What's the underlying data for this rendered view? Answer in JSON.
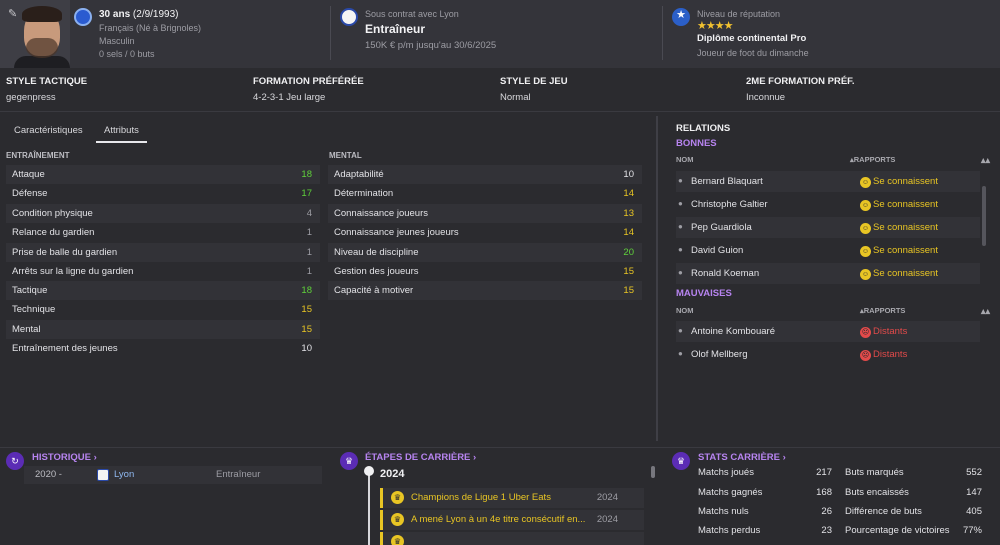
{
  "header": {
    "age": "30 ans",
    "birthdate": "(2/9/1993)",
    "nationality": "Français (Né à Brignoles)",
    "gender": "Masculin",
    "caps": "0 sels / 0 buts",
    "contract_label": "Sous contrat avec Lyon",
    "role": "Entraîneur",
    "salary": "150K € p/m jusqu'au 30/6/2025",
    "reputation_label": "Niveau de réputation",
    "reputation_stars": "★★★★",
    "diploma": "Diplôme continental Pro",
    "playing_level": "Joueur de foot du dimanche"
  },
  "tactics": [
    {
      "label": "STYLE TACTIQUE",
      "value": "gegenpress"
    },
    {
      "label": "FORMATION PRÉFÉRÉE",
      "value": "4-2-3-1 Jeu large"
    },
    {
      "label": "STYLE DE JEU",
      "value": "Normal"
    },
    {
      "label": "2ME FORMATION PRÉF.",
      "value": "Inconnue"
    }
  ],
  "tabs": [
    "Caractéristiques",
    "Attributs"
  ],
  "training": {
    "label": "ENTRAÎNEMENT",
    "rows": [
      {
        "name": "Attaque",
        "value": "18"
      },
      {
        "name": "Défense",
        "value": "17"
      },
      {
        "name": "Condition physique",
        "value": "4"
      },
      {
        "name": "Relance du gardien",
        "value": "1"
      },
      {
        "name": "Prise de balle du gardien",
        "value": "1"
      },
      {
        "name": "Arrêts sur la ligne du gardien",
        "value": "1"
      },
      {
        "name": "Tactique",
        "value": "18"
      },
      {
        "name": "Technique",
        "value": "15"
      },
      {
        "name": "Mental",
        "value": "15"
      },
      {
        "name": "Entraînement des jeunes",
        "value": "10"
      }
    ]
  },
  "mental": {
    "label": "MENTAL",
    "rows": [
      {
        "name": "Adaptabilité",
        "value": "10"
      },
      {
        "name": "Détermination",
        "value": "14"
      },
      {
        "name": "Connaissance joueurs",
        "value": "13"
      },
      {
        "name": "Connaissance jeunes joueurs",
        "value": "14"
      },
      {
        "name": "Niveau de discipline",
        "value": "20"
      },
      {
        "name": "Gestion des joueurs",
        "value": "15"
      },
      {
        "name": "Capacité à motiver",
        "value": "15"
      }
    ]
  },
  "relations": {
    "title": "RELATIONS",
    "good_label": "BONNES",
    "bad_label": "MAUVAISES",
    "col_name": "NOM",
    "col_reports": "▴RAPPORTS",
    "sort_arrows": "▴▴",
    "good": [
      {
        "name": "Bernard Blaquart",
        "status": "Se connaissent"
      },
      {
        "name": "Christophe Galtier",
        "status": "Se connaissent"
      },
      {
        "name": "Pep Guardiola",
        "status": "Se connaissent"
      },
      {
        "name": "David Guion",
        "status": "Se connaissent"
      },
      {
        "name": "Ronald Koeman",
        "status": "Se connaissent"
      }
    ],
    "bad": [
      {
        "name": "Antoine Kombouaré",
        "status": "Distants"
      },
      {
        "name": "Olof Mellberg",
        "status": "Distants"
      }
    ]
  },
  "history": {
    "title": "HISTORIQUE ›",
    "rows": [
      {
        "years": "2020 -",
        "club": "Lyon",
        "role": "Entraîneur"
      }
    ]
  },
  "career": {
    "title": "ÉTAPES DE CARRIÈRE ›",
    "year": "2024",
    "milestones": [
      {
        "text": "Champions de Ligue 1 Uber Eats",
        "year": "2024"
      },
      {
        "text": "A mené Lyon à un 4e titre consécutif en...",
        "year": "2024"
      }
    ]
  },
  "stats": {
    "title": "STATS CARRIÈRE ›",
    "left": [
      {
        "label": "Matchs joués",
        "value": "217"
      },
      {
        "label": "Matchs gagnés",
        "value": "168"
      },
      {
        "label": "Matchs nuls",
        "value": "26"
      },
      {
        "label": "Matchs perdus",
        "value": "23"
      }
    ],
    "right": [
      {
        "label": "Buts marqués",
        "value": "552"
      },
      {
        "label": "Buts encaissés",
        "value": "147"
      },
      {
        "label": "Différence de buts",
        "value": "405"
      },
      {
        "label": "Pourcentage de victoires",
        "value": "77%"
      }
    ]
  },
  "colors": {
    "green": "#5fd13a",
    "yellow": "#e8c524",
    "purple": "#b784f0",
    "red": "#e24a4a"
  }
}
